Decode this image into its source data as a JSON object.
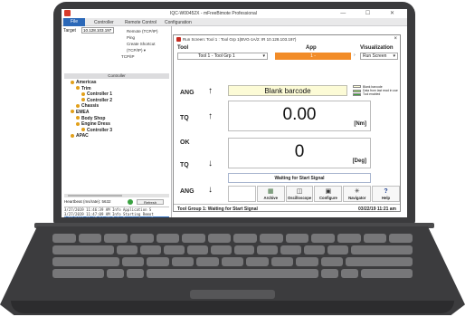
{
  "app": {
    "title": "IQC-W00452X - mFreeBimote Professional",
    "window_controls": "—  ☐  ✕"
  },
  "ribbon": {
    "tabs": [
      "File",
      "Controller",
      "Remote Control",
      "Configuration"
    ]
  },
  "left_pane": {
    "target_label": "Target",
    "target_value": "10.128.103.197",
    "remote_items": [
      "Remote (TCP/IP)",
      "Ping",
      "Create Shortcut (TCP/IP) ▾",
      "TCP/IP"
    ],
    "controller_header": "Controller",
    "tree": [
      {
        "label": "Americas",
        "level": 0,
        "color": "#e2a01a",
        "bold": true
      },
      {
        "label": "Trim",
        "level": 1,
        "color": "#e2a01a",
        "bold": true
      },
      {
        "label": "Controller 1",
        "level": 2,
        "color": "#e2a01a",
        "bold": true
      },
      {
        "label": "Controller 2",
        "level": 2,
        "color": "#e2a01a",
        "bold": true
      },
      {
        "label": "Chassis",
        "level": 1,
        "color": "#e2a01a",
        "bold": true
      },
      {
        "label": "EMEA",
        "level": 0,
        "color": "#e2a01a",
        "bold": true
      },
      {
        "label": "Body Shop",
        "level": 1,
        "color": "#e2a01a",
        "bold": true
      },
      {
        "label": "Engine Dress",
        "level": 1,
        "color": "#e2a01a",
        "bold": true
      },
      {
        "label": "Controller 3",
        "level": 2,
        "color": "#e2a01a",
        "bold": true
      },
      {
        "label": "APAC",
        "level": 0,
        "color": "#e2a01a",
        "bold": true
      }
    ],
    "refresh_rate": "Heartbeat (ms/rate): 5632",
    "refresh_button": "Refresh",
    "log": [
      {
        "text": "3/27/2019 11:46:39 AM  Info   Application S",
        "selected": false
      },
      {
        "text": "3/27/2019 11:47:09 AM  Info   Starting Remot",
        "selected": false
      },
      {
        "text": "3/27/2019 11:47:14 AM  Info   Remote Control",
        "selected": true
      }
    ]
  },
  "run_screen": {
    "title": "Run Screen: Tool 1 : Tool Grp 1(BVG-1A/2: IR 10.128.103.197)",
    "close": "×",
    "headers": {
      "tool": "Tool",
      "app": "App",
      "visualization": "Visualization"
    },
    "tool_select": "Tool 1 - Tool Grp 1",
    "app_select": "1 -",
    "visualization_select": "Run Screen",
    "labels": {
      "ang": "ANG",
      "tq": "TQ",
      "ok": "OK"
    },
    "barcode": "Blank barcode",
    "legend": [
      {
        "label": "Blank barcode",
        "color": "#fcfbd6"
      },
      {
        "label": "Data from last read in use",
        "color": "#8dd35a"
      },
      {
        "label": "Tool enabled",
        "color": "#3fa33b"
      }
    ],
    "torque": {
      "value": "0.00",
      "unit": "[Nm]"
    },
    "angle": {
      "value": "0",
      "unit": "[Deg]"
    },
    "status": "Waiting for Start Signal",
    "toolbar": [
      {
        "label": "",
        "icon": "blank-icon"
      },
      {
        "label": "Archive",
        "icon": "archive-icon"
      },
      {
        "label": "Oscilloscope",
        "icon": "oscilloscope-icon"
      },
      {
        "label": "Configure",
        "icon": "configure-icon"
      },
      {
        "label": "Navigator",
        "icon": "navigator-icon"
      },
      {
        "label": "Help",
        "icon": "help-icon"
      }
    ],
    "footer_left": "Tool Group 1: Waiting for Start Signal",
    "footer_right": "03/22/19 11:21 am"
  }
}
